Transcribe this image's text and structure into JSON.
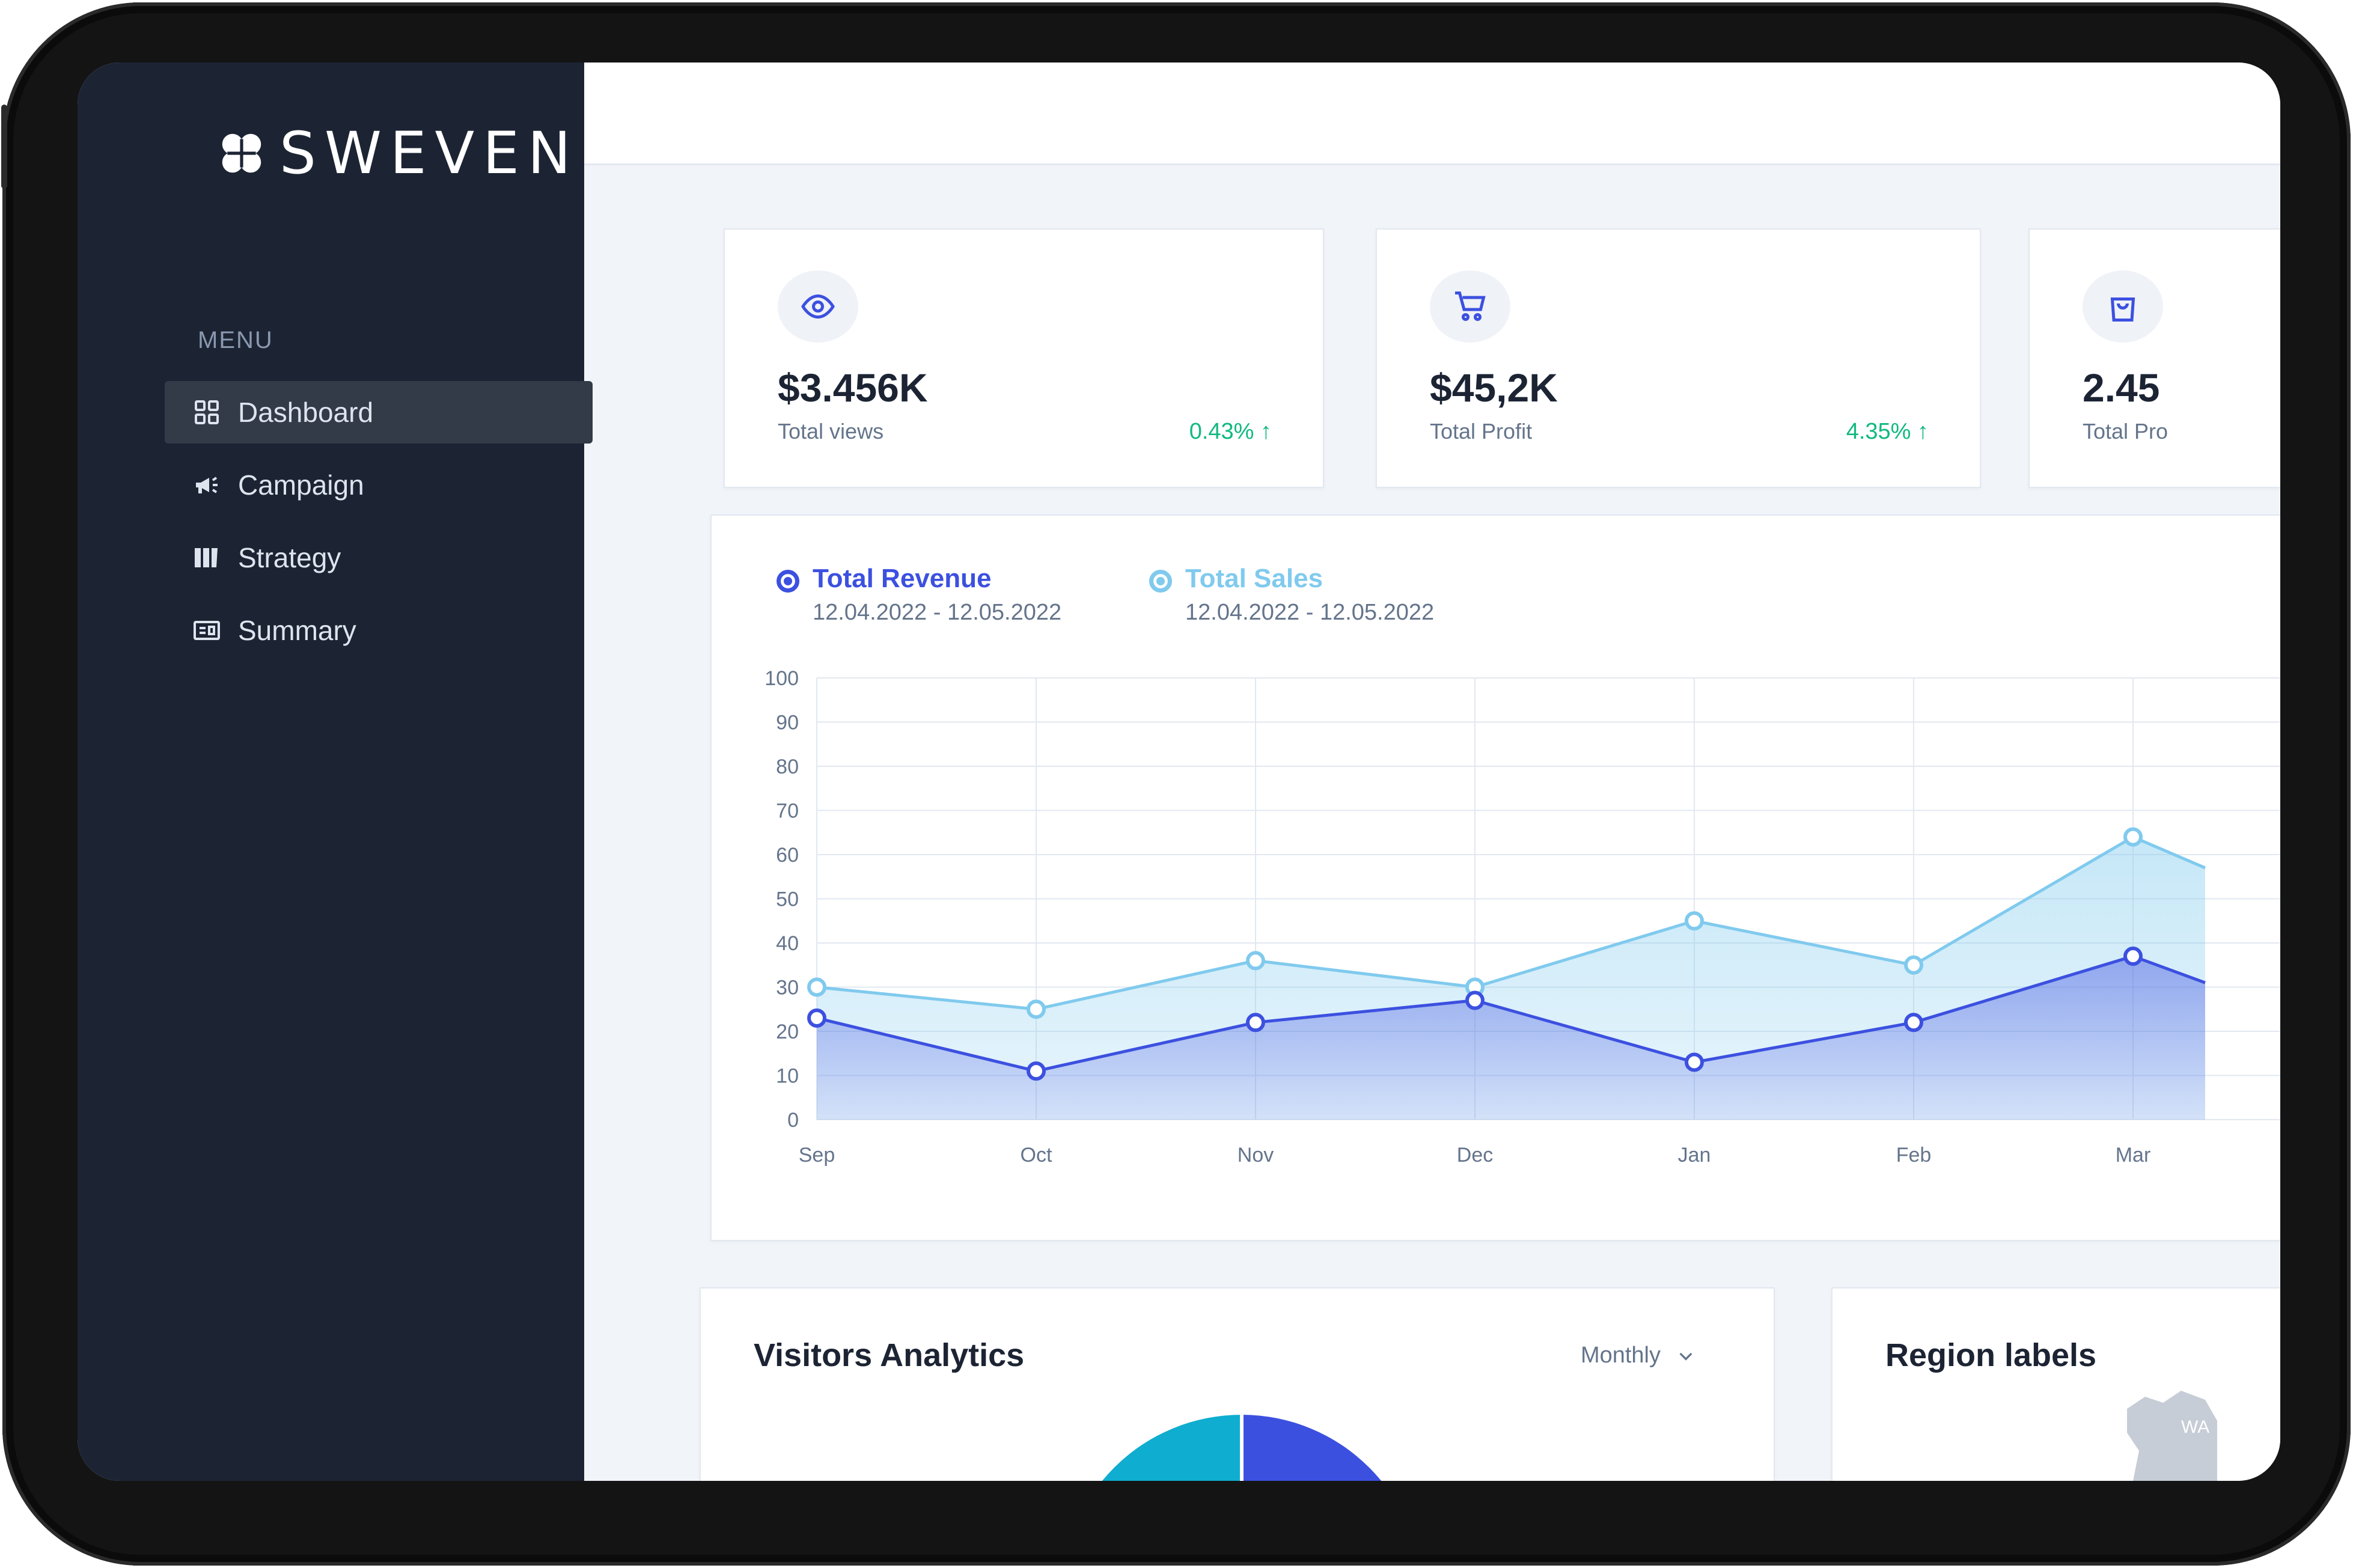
{
  "brand": {
    "name": "SWEVEN",
    "logo_icon": "clover-icon"
  },
  "sidebar": {
    "menu_heading": "MENU",
    "items": [
      {
        "label": "Dashboard",
        "icon": "grid-icon",
        "active": true
      },
      {
        "label": "Campaign",
        "icon": "megaphone-icon",
        "active": false
      },
      {
        "label": "Strategy",
        "icon": "columns-icon",
        "active": false
      },
      {
        "label": "Summary",
        "icon": "id-card-icon",
        "active": false
      }
    ]
  },
  "stats": [
    {
      "value": "$3.456K",
      "label": "Total views",
      "change": "0.43%",
      "trend": "up",
      "icon": "eye-icon"
    },
    {
      "value": "$45,2K",
      "label": "Total Profit",
      "change": "4.35%",
      "trend": "up",
      "icon": "cart-icon"
    },
    {
      "value": "2.45",
      "label": "Total Pro",
      "icon": "shopping-bag-icon"
    }
  ],
  "chart": {
    "legend": [
      {
        "name": "Total Revenue",
        "range": "12.04.2022 - 12.05.2022",
        "color": "#3c50e0"
      },
      {
        "name": "Total Sales",
        "range": "12.04.2022 - 12.05.2022",
        "color": "#80caee"
      }
    ]
  },
  "chart_data": {
    "type": "area",
    "x": [
      "Sep",
      "Oct",
      "Nov",
      "Dec",
      "Jan",
      "Feb",
      "Mar"
    ],
    "series": [
      {
        "name": "Total Revenue",
        "values": [
          23,
          11,
          22,
          27,
          13,
          22,
          37
        ],
        "color": "#3c50e0"
      },
      {
        "name": "Total Sales",
        "values": [
          30,
          25,
          36,
          30,
          45,
          35,
          64
        ],
        "color": "#80caee"
      }
    ],
    "ylim": [
      0,
      100
    ],
    "yticks": [
      0,
      10,
      20,
      30,
      40,
      50,
      60,
      70,
      80,
      90,
      100
    ],
    "grid": true
  },
  "visitors": {
    "title": "Visitors Analytics",
    "period": "Monthly",
    "donut_colors": [
      "#0fadcf",
      "#3c50e0"
    ]
  },
  "region": {
    "title": "Region labels",
    "map_label": "WA"
  }
}
